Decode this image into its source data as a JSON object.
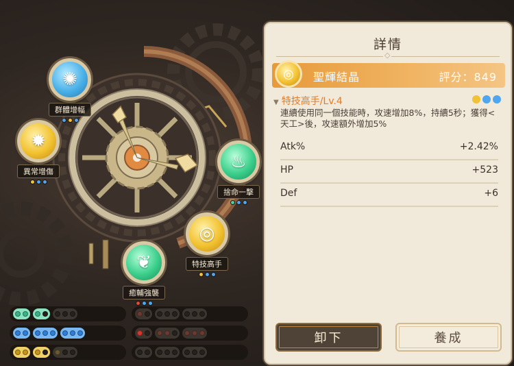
{
  "nodes": [
    {
      "id": "group-boost",
      "label": "群體增幅",
      "icon": "wind-icon",
      "color": "blue",
      "dots": [
        "b",
        "y",
        "b"
      ]
    },
    {
      "id": "anomaly-boost",
      "label": "異常增傷",
      "icon": "sun-icon",
      "color": "gold",
      "dots": [
        "y",
        "b",
        "b"
      ]
    },
    {
      "id": "all-in-strike",
      "label": "捨命一擊",
      "icon": "flame-icon",
      "color": "green",
      "dots": [
        "g",
        "b",
        "b"
      ]
    },
    {
      "id": "skill-expert",
      "label": "特技高手",
      "icon": "spiral-icon",
      "color": "gold",
      "dots": [
        "y",
        "b",
        "b"
      ]
    },
    {
      "id": "heal-enhance",
      "label": "癒輔強襲",
      "icon": "leaf-icon",
      "color": "green",
      "dots": [
        "r",
        "b",
        "b"
      ]
    }
  ],
  "slots": [
    {
      "left": [
        "teal2",
        "teal1",
        "dark2"
      ],
      "right": [
        "red-dark",
        "dark2",
        "dark2"
      ]
    },
    {
      "left": [
        "blue2",
        "blue2",
        "blue3"
      ],
      "right": [
        "red-r",
        "dark2",
        "dark2"
      ]
    },
    {
      "left": [
        "gold2",
        "gold1",
        "dark2"
      ],
      "right": [
        "dark2",
        "dark2",
        "dark2"
      ]
    }
  ],
  "panel": {
    "title": "詳情",
    "crystal_name": "聖輝結晶",
    "score_label": "評分：849",
    "skill_name": "特技高手/Lv.4",
    "skill_dots": [
      "y",
      "b",
      "b"
    ],
    "skill_desc": "連續使用同一個技能時，攻速增加8%，持續5秒；獲得<天工>後，攻速額外增加5%",
    "stats": [
      {
        "key": "Atk%",
        "value": "+2.42%"
      },
      {
        "key": "HP",
        "value": "+523"
      },
      {
        "key": "Def",
        "value": "+6"
      }
    ],
    "unequip_label": "卸下",
    "upgrade_label": "養成"
  },
  "colors": {
    "accent_orange": "#e07d2a",
    "panel_bg": "#f1e9d9",
    "dot_blue": "#4fa6ee",
    "dot_yellow": "#f1c237",
    "dot_red": "#e04a3a",
    "dot_green": "#45d39a"
  }
}
